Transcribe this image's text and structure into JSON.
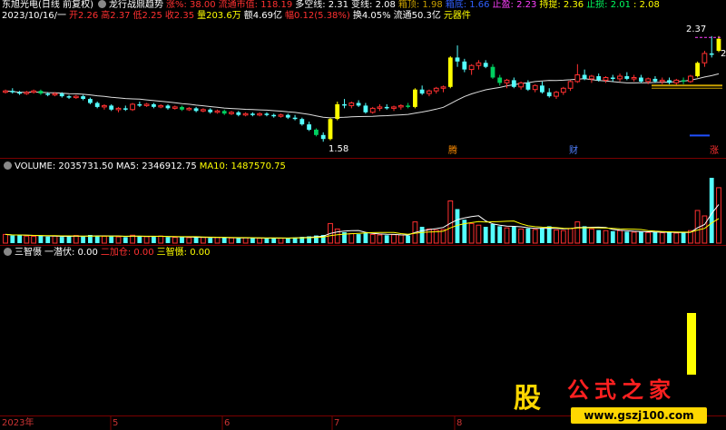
{
  "main_panel": {
    "stock_title": "东旭光电(日线 前复权)",
    "indicator_name": "龙行战鼎趋势",
    "indicators": [
      {
        "label": "涨%: 38.00",
        "color": "#ff3030"
      },
      {
        "label": "流通市值: 118.19",
        "color": "#ff3030"
      },
      {
        "label": "多空线: 2.31",
        "color": "#ffffff"
      },
      {
        "label": "变线: 2.08",
        "color": "#ffffff"
      },
      {
        "label": "箱顶: 1.98",
        "color": "#c8a000"
      },
      {
        "label": "箱底: 1.66",
        "color": "#3060ff"
      },
      {
        "label": "止盈: 2.23",
        "color": "#ff40ff"
      },
      {
        "label": "持提: 2.36",
        "color": "#ffff00"
      },
      {
        "label": "止损: 2.01",
        "color": "#00ff60"
      },
      {
        "label": ": 2.08",
        "color": "#ffff00"
      }
    ],
    "quote": [
      {
        "label": "2023/10/16/一",
        "color": "#ffffff"
      },
      {
        "label": "开2.26",
        "color": "#ff3030"
      },
      {
        "label": "高2.37",
        "color": "#ff3030"
      },
      {
        "label": "低2.25",
        "color": "#ff3030"
      },
      {
        "label": "收2.35",
        "color": "#ff3030"
      },
      {
        "label": "量203.6万",
        "color": "#ffff00"
      },
      {
        "label": "额4.69亿",
        "color": "#ffffff"
      },
      {
        "label": "幅0.12(5.38%)",
        "color": "#ff3030"
      },
      {
        "label": "换4.05%",
        "color": "#ffffff"
      },
      {
        "label": "流通50.3亿",
        "color": "#ffffff"
      },
      {
        "label": "元器件",
        "color": "#ffff00"
      }
    ],
    "price_high_label": "2.37",
    "price_low_label": "1.58",
    "price_right_label": "2",
    "events": [
      {
        "label": "腾",
        "color": "#ff8c00"
      },
      {
        "label": "财",
        "color": "#5080ff"
      },
      {
        "label": "涨",
        "color": "#ff3030"
      }
    ]
  },
  "volume_panel": {
    "label": "VOLUME: 2035731.50",
    "ma5": "MA5: 2346912.75",
    "ma10": "MA10: 1487570.75"
  },
  "signal_panel": {
    "title": "三智慑",
    "items": [
      {
        "label": "一潜伏: 0.00",
        "color": "#ffffff"
      },
      {
        "label": "二加仓: 0.00",
        "color": "#ff3030"
      },
      {
        "label": "三智慑: 0.00",
        "color": "#ffff00"
      }
    ]
  },
  "time_axis": [
    "2023年",
    "5",
    "6",
    "7",
    "8"
  ],
  "watermark": {
    "logo_text": "股",
    "title": "公式之家",
    "url": "www.gszj100.com"
  },
  "chart_data": {
    "type": "candlestick",
    "price_range": [
      1.5,
      2.45
    ],
    "volume_max": 2400000,
    "candles": [
      [
        1.95,
        1.97,
        1.94,
        1.96
      ],
      [
        1.96,
        1.98,
        1.94,
        1.95
      ],
      [
        1.95,
        1.96,
        1.93,
        1.94
      ],
      [
        1.94,
        1.96,
        1.93,
        1.95
      ],
      [
        1.95,
        1.97,
        1.94,
        1.96
      ],
      [
        1.96,
        1.97,
        1.93,
        1.94
      ],
      [
        1.94,
        1.95,
        1.92,
        1.93
      ],
      [
        1.93,
        1.95,
        1.92,
        1.94
      ],
      [
        1.94,
        1.95,
        1.91,
        1.92
      ],
      [
        1.92,
        1.93,
        1.9,
        1.91
      ],
      [
        1.91,
        1.93,
        1.9,
        1.92
      ],
      [
        1.92,
        1.93,
        1.89,
        1.9
      ],
      [
        1.9,
        1.91,
        1.86,
        1.87
      ],
      [
        1.87,
        1.88,
        1.83,
        1.84
      ],
      [
        1.84,
        1.86,
        1.82,
        1.85
      ],
      [
        1.85,
        1.86,
        1.81,
        1.82
      ],
      [
        1.82,
        1.84,
        1.8,
        1.83
      ],
      [
        1.83,
        1.85,
        1.81,
        1.82
      ],
      [
        1.82,
        1.87,
        1.81,
        1.86
      ],
      [
        1.86,
        1.88,
        1.84,
        1.85
      ],
      [
        1.85,
        1.87,
        1.84,
        1.86
      ],
      [
        1.86,
        1.87,
        1.83,
        1.84
      ],
      [
        1.84,
        1.86,
        1.83,
        1.85
      ],
      [
        1.85,
        1.86,
        1.82,
        1.83
      ],
      [
        1.83,
        1.85,
        1.82,
        1.84
      ],
      [
        1.84,
        1.85,
        1.81,
        1.82
      ],
      [
        1.82,
        1.84,
        1.81,
        1.83
      ],
      [
        1.83,
        1.84,
        1.8,
        1.81
      ],
      [
        1.81,
        1.83,
        1.8,
        1.82
      ],
      [
        1.82,
        1.83,
        1.79,
        1.8
      ],
      [
        1.8,
        1.82,
        1.79,
        1.81
      ],
      [
        1.81,
        1.82,
        1.78,
        1.79
      ],
      [
        1.79,
        1.81,
        1.78,
        1.8
      ],
      [
        1.8,
        1.81,
        1.77,
        1.78
      ],
      [
        1.78,
        1.8,
        1.77,
        1.79
      ],
      [
        1.79,
        1.8,
        1.77,
        1.78
      ],
      [
        1.78,
        1.8,
        1.77,
        1.79
      ],
      [
        1.79,
        1.8,
        1.77,
        1.78
      ],
      [
        1.78,
        1.79,
        1.76,
        1.77
      ],
      [
        1.77,
        1.79,
        1.76,
        1.78
      ],
      [
        1.78,
        1.79,
        1.75,
        1.76
      ],
      [
        1.76,
        1.78,
        1.74,
        1.75
      ],
      [
        1.75,
        1.76,
        1.7,
        1.71
      ],
      [
        1.71,
        1.73,
        1.66,
        1.67
      ],
      [
        1.67,
        1.68,
        1.62,
        1.63
      ],
      [
        1.63,
        1.65,
        1.58,
        1.6
      ],
      [
        1.6,
        1.76,
        1.59,
        1.75
      ],
      [
        1.75,
        1.88,
        1.74,
        1.86
      ],
      [
        1.86,
        1.9,
        1.83,
        1.85
      ],
      [
        1.85,
        1.88,
        1.83,
        1.87
      ],
      [
        1.87,
        1.89,
        1.84,
        1.85
      ],
      [
        1.85,
        1.87,
        1.79,
        1.8
      ],
      [
        1.8,
        1.84,
        1.79,
        1.83
      ],
      [
        1.83,
        1.86,
        1.81,
        1.84
      ],
      [
        1.84,
        1.86,
        1.82,
        1.83
      ],
      [
        1.83,
        1.85,
        1.81,
        1.84
      ],
      [
        1.84,
        1.86,
        1.82,
        1.85
      ],
      [
        1.85,
        1.87,
        1.83,
        1.84
      ],
      [
        1.84,
        1.98,
        1.83,
        1.97
      ],
      [
        1.97,
        2.0,
        1.93,
        1.94
      ],
      [
        1.94,
        1.97,
        1.92,
        1.96
      ],
      [
        1.96,
        1.99,
        1.94,
        1.98
      ],
      [
        1.98,
        2.0,
        1.95,
        1.99
      ],
      [
        1.99,
        2.22,
        1.98,
        2.21
      ],
      [
        2.21,
        2.3,
        2.14,
        2.18
      ],
      [
        2.18,
        2.2,
        2.1,
        2.12
      ],
      [
        2.12,
        2.16,
        2.08,
        2.15
      ],
      [
        2.15,
        2.19,
        2.12,
        2.17
      ],
      [
        2.17,
        2.19,
        2.13,
        2.14
      ],
      [
        2.14,
        2.16,
        2.05,
        2.06
      ],
      [
        2.06,
        2.08,
        2.0,
        2.02
      ],
      [
        2.02,
        2.05,
        1.98,
        2.04
      ],
      [
        2.04,
        2.06,
        1.98,
        1.99
      ],
      [
        1.99,
        2.03,
        1.97,
        2.02
      ],
      [
        2.02,
        2.04,
        1.96,
        1.97
      ],
      [
        1.97,
        2.01,
        1.95,
        2.0
      ],
      [
        2.0,
        2.03,
        1.94,
        1.95
      ],
      [
        1.95,
        1.98,
        1.91,
        1.92
      ],
      [
        1.92,
        1.96,
        1.9,
        1.95
      ],
      [
        1.95,
        1.99,
        1.93,
        1.98
      ],
      [
        1.98,
        2.04,
        1.96,
        2.03
      ],
      [
        2.03,
        2.16,
        2.02,
        2.08
      ],
      [
        2.08,
        2.12,
        2.04,
        2.05
      ],
      [
        2.05,
        2.08,
        2.02,
        2.07
      ],
      [
        2.07,
        2.09,
        2.03,
        2.04
      ],
      [
        2.04,
        2.07,
        2.02,
        2.06
      ],
      [
        2.06,
        2.08,
        2.03,
        2.05
      ],
      [
        2.05,
        2.09,
        2.03,
        2.07
      ],
      [
        2.07,
        2.1,
        2.04,
        2.05
      ],
      [
        2.05,
        2.08,
        2.03,
        2.06
      ],
      [
        2.06,
        2.08,
        2.02,
        2.03
      ],
      [
        2.03,
        2.06,
        2.01,
        2.05
      ],
      [
        2.05,
        2.07,
        2.02,
        2.03
      ],
      [
        2.03,
        2.06,
        2.01,
        2.04
      ],
      [
        2.04,
        2.06,
        2.01,
        2.02
      ],
      [
        2.02,
        2.05,
        2.0,
        2.04
      ],
      [
        2.04,
        2.06,
        2.01,
        2.03
      ],
      [
        2.03,
        2.08,
        2.02,
        2.07
      ],
      [
        2.07,
        2.18,
        2.06,
        2.17
      ],
      [
        2.17,
        2.26,
        2.14,
        2.24
      ],
      [
        2.24,
        2.37,
        2.21,
        2.23
      ],
      [
        2.26,
        2.37,
        2.25,
        2.35
      ]
    ],
    "volumes": [
      320000,
      280000,
      300000,
      260000,
      250000,
      270000,
      240000,
      260000,
      230000,
      250000,
      280000,
      240000,
      300000,
      260000,
      250000,
      270000,
      230000,
      220000,
      290000,
      250000,
      240000,
      230000,
      260000,
      220000,
      210000,
      230000,
      200000,
      220000,
      210000,
      190000,
      210000,
      200000,
      190000,
      180000,
      200000,
      190000,
      180000,
      170000,
      190000,
      180000,
      200000,
      210000,
      230000,
      250000,
      280000,
      300000,
      720000,
      520000,
      400000,
      350000,
      330000,
      380000,
      320000,
      300000,
      290000,
      310000,
      300000,
      280000,
      780000,
      600000,
      520000,
      480000,
      500000,
      1550000,
      1250000,
      860000,
      720000,
      660000,
      600000,
      700000,
      620000,
      560000,
      600000,
      520000,
      540000,
      500000,
      560000,
      620000,
      480000,
      460000,
      540000,
      780000,
      620000,
      520000,
      480000,
      460000,
      440000,
      460000,
      420000,
      400000,
      420000,
      390000,
      410000,
      380000,
      400000,
      370000,
      380000,
      460000,
      1200000,
      1000000,
      2400000,
      2035731
    ]
  }
}
